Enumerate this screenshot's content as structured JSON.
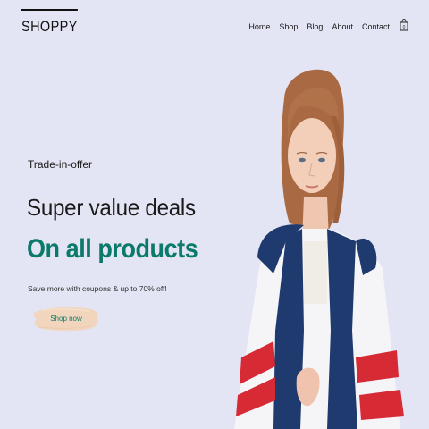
{
  "brand": {
    "name": "SHOPPY"
  },
  "nav": {
    "items": [
      {
        "label": "Home"
      },
      {
        "label": "Shop"
      },
      {
        "label": "Blog"
      },
      {
        "label": "About"
      },
      {
        "label": "Contact"
      }
    ],
    "cart_icon": "shopping-bag-icon",
    "cart_count": "0"
  },
  "hero": {
    "kicker": "Trade-in-offer",
    "headline": "Super value deals",
    "subheadline": "On all products",
    "tagline": "Save more with coupons & up to 70% off!",
    "button_label": "Shop now"
  },
  "colors": {
    "background": "#e3e5f4",
    "accent": "#0c7a6a",
    "button_brush": "#f1d6bd",
    "text": "#1a1a1a"
  }
}
